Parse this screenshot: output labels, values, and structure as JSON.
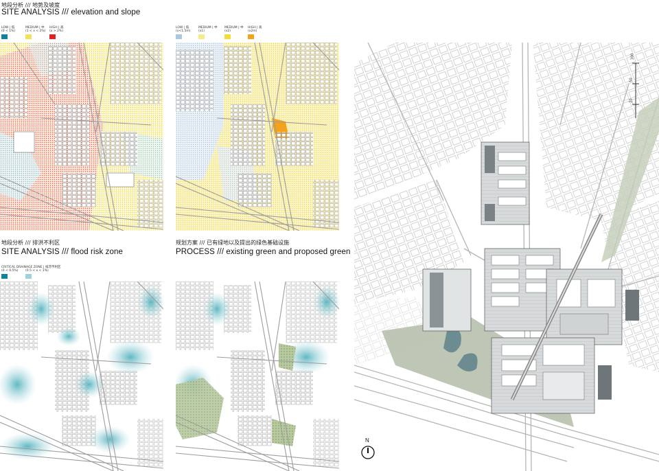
{
  "panels": {
    "elevation": {
      "cn_title": "地段分析 /// 地势及坡度",
      "title_prefix": "SITE ANALYSIS",
      "title_sep": " /// ",
      "title_rest": "elevation and slope",
      "legend": [
        {
          "label": "LOW | 低",
          "sub": "(0 < 1%)",
          "color": "#14829a"
        },
        {
          "label": "MEDIUM | 中",
          "sub": "(1 < x < 2%)",
          "color": "#f2e15a"
        },
        {
          "label": "HIGH | 高",
          "sub": "(x > 2%)",
          "color": "#e02424"
        }
      ]
    },
    "slope": {
      "legend": [
        {
          "label": "LOW | 低",
          "sub": "(x<1.5m)",
          "color": "#a9c9e2"
        },
        {
          "label": "MEDIUM | 中",
          "sub": "(x1)",
          "color": "#f4ec8a"
        },
        {
          "label": "MEDIUM | 中",
          "sub": "(x2)",
          "color": "#f2dc3a"
        },
        {
          "label": "HIGH | 高",
          "sub": "(x2m)",
          "color": "#f4a21c"
        }
      ]
    },
    "flood": {
      "cn_title": "地段分析 /// 排洪不利区",
      "title_prefix": "SITE ANALYSIS",
      "title_sep": " /// ",
      "title_rest": "flood risk zone",
      "legend": [
        {
          "label": "CRITICAL DRAINAGE ZONE | 排涝不利区",
          "sub": "(0 < 0.5%)",
          "color": "#14829a"
        },
        {
          "label": "",
          "sub": "(0.5 < x < 1%)",
          "color": "#9ed2dc"
        }
      ]
    },
    "process": {
      "cn_title": "规划方案 /// 已有绿地以及提出的绿色基础设施",
      "title_prefix": "PROCESS",
      "title_sep": " /// ",
      "title_rest": "existing green and proposed green"
    }
  },
  "masterplan": {
    "north_label": "N",
    "scale_labels": [
      "100",
      "50",
      "20"
    ]
  },
  "colors": {
    "road": "#bdbdbd",
    "building_stroke": "#555555",
    "green_existing": "#9bb27d",
    "water": "#7ec5cf"
  }
}
